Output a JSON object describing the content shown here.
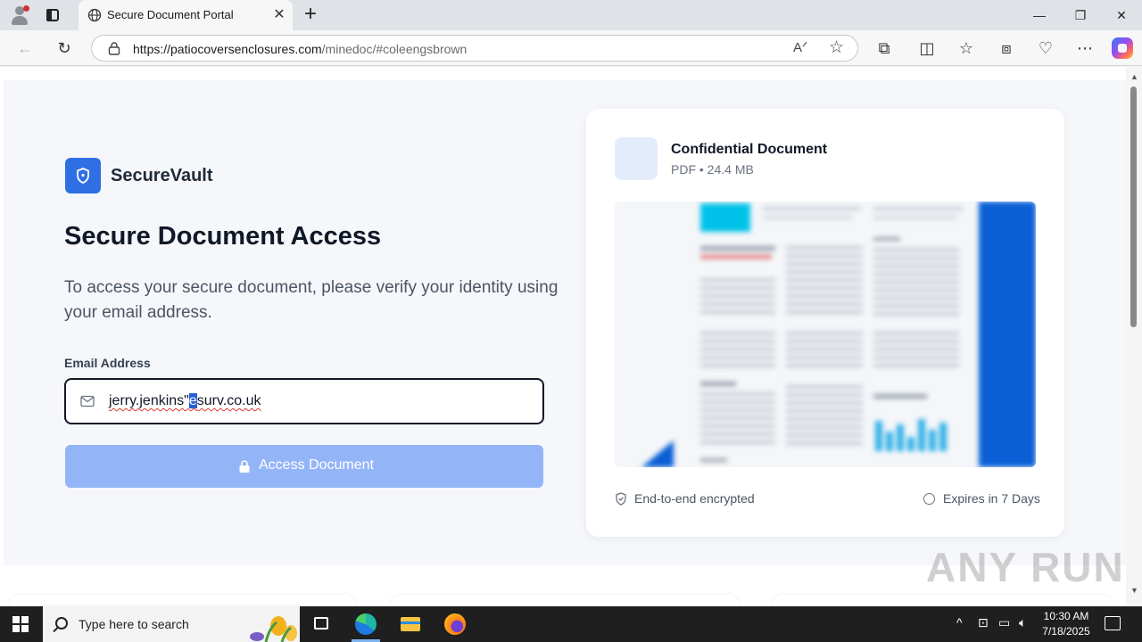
{
  "browser": {
    "tab_title": "Secure Document Portal",
    "url_host": "https://patiocoversenclosures.com",
    "url_path": "/minedoc/#coleengsbrown"
  },
  "page": {
    "brand_name": "SecureVault",
    "headline": "Secure Document Access",
    "subtext": "To access your secure document, please verify your identity using your email address.",
    "email_label": "Email Address",
    "email_value_before": "jerry.jenkins\"",
    "email_value_caret": "e",
    "email_value_after": "surv.co.uk",
    "access_button": "Access Document"
  },
  "document_card": {
    "title": "Confidential Document",
    "meta": "PDF • 24.4 MB",
    "encrypted_label": "End-to-end encrypted",
    "expires_label": "Expires in 7 Days"
  },
  "watermark": "ANY RUN",
  "taskbar": {
    "search_placeholder": "Type here to search",
    "time": "10:30 AM",
    "date": "7/18/2025"
  },
  "colors": {
    "accent": "#2f6fe4",
    "button_disabled": "#93b5f8",
    "doc_icon_bg": "#e3ecfb"
  },
  "icons": [
    "profile-icon",
    "tab-actions-icon",
    "globe-icon",
    "close-icon",
    "new-tab-icon",
    "back-icon",
    "refresh-icon",
    "site-info-icon",
    "read-aloud-icon",
    "favorite-star-icon",
    "extensions-icon",
    "split-screen-icon",
    "favorites-icon",
    "collections-icon",
    "browser-essentials-icon",
    "more-icon",
    "copilot-icon",
    "shield-icon",
    "mail-icon",
    "lock-icon",
    "document-icon",
    "shield-check-icon",
    "clock-icon",
    "windows-start-icon",
    "search-icon",
    "task-view-icon",
    "edge-icon",
    "file-explorer-icon",
    "firefox-icon"
  ]
}
